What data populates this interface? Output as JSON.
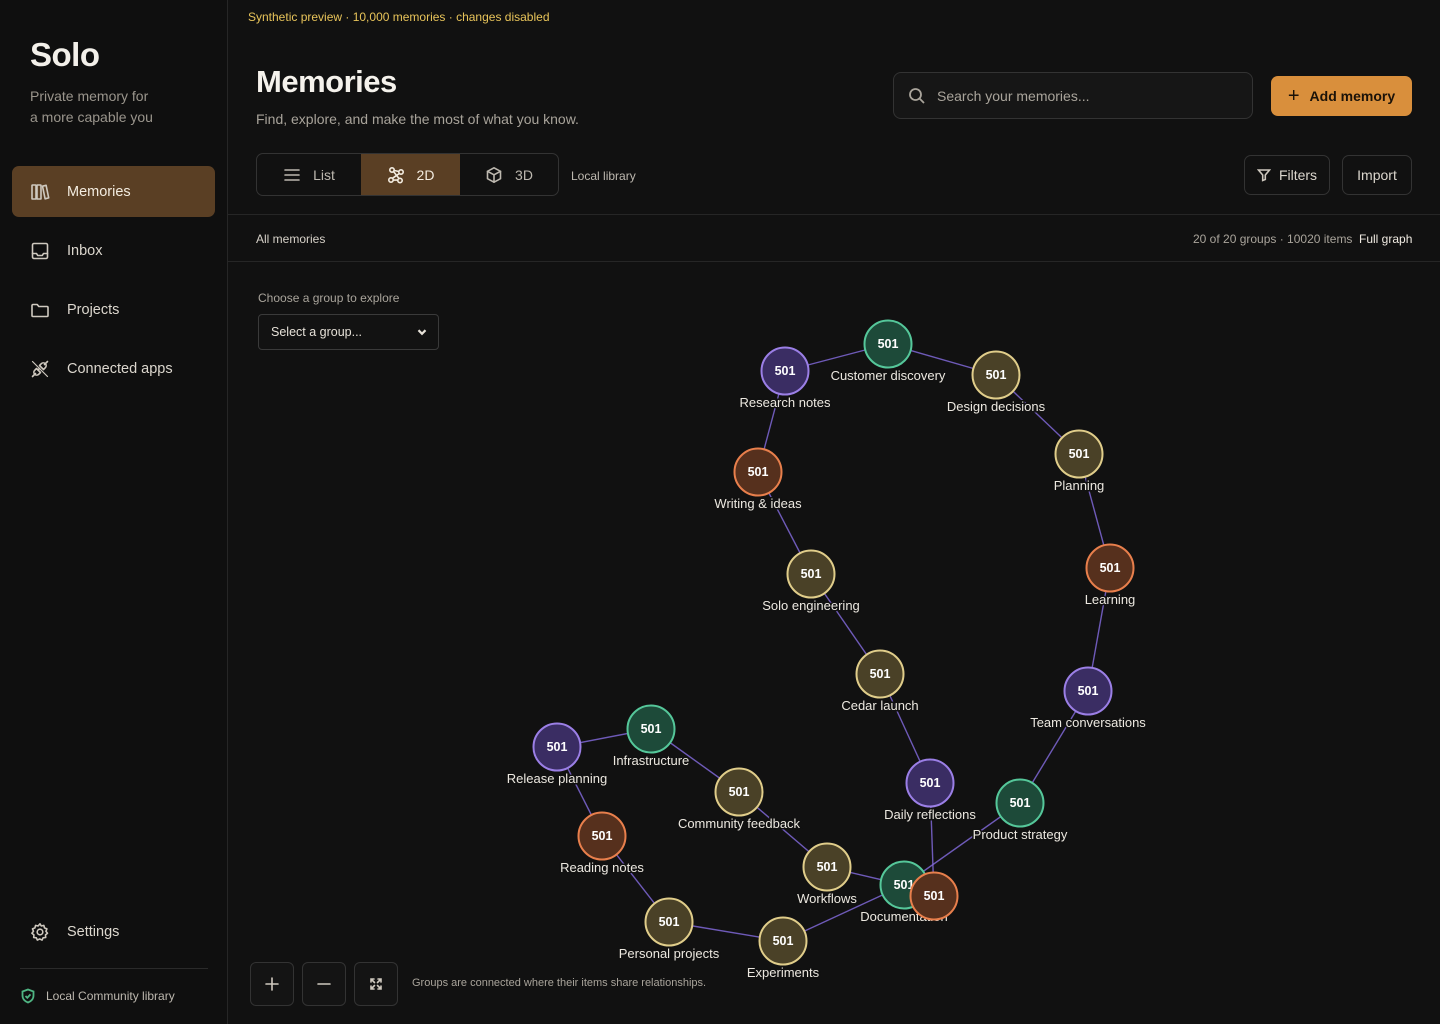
{
  "sidebar": {
    "brand": "Solo",
    "tagline_line1": "Private memory for",
    "tagline_line2": "a more capable you",
    "items": [
      {
        "label": "Memories",
        "icon": "books-icon",
        "active": true
      },
      {
        "label": "Inbox",
        "icon": "inbox-icon",
        "active": false
      },
      {
        "label": "Projects",
        "icon": "folder-icon",
        "active": false
      },
      {
        "label": "Connected apps",
        "icon": "plug-icon",
        "active": false
      }
    ],
    "settings_label": "Settings",
    "library_status": "Local Community library"
  },
  "banner": "Synthetic preview · 10,000 memories · changes disabled",
  "header": {
    "title": "Memories",
    "subtitle": "Find, explore, and make the most of what you know.",
    "search_placeholder": "Search your memories...",
    "add_label": "Add memory"
  },
  "toolbar": {
    "views": [
      {
        "label": "List",
        "icon": "list-icon",
        "active": false
      },
      {
        "label": "2D",
        "icon": "graph-2d-icon",
        "active": true
      },
      {
        "label": "3D",
        "icon": "cube-icon",
        "active": false
      }
    ],
    "library_label": "Local library",
    "filters_label": "Filters",
    "import_label": "Import"
  },
  "subheader": {
    "crumb": "All memories",
    "counts": "20 of 20 groups · 10020 items",
    "mode": "Full graph"
  },
  "explorer": {
    "choose_label": "Choose a group to explore",
    "select_value": "Select a group..."
  },
  "colors": {
    "accent": "#d98f3c",
    "active_bg": "#5a3f24",
    "purple": "#9b7fe6",
    "green": "#55c79a",
    "tan": "#e0cd8a",
    "orange": "#e87f4c",
    "edge": "#7f67d6"
  },
  "graph": {
    "nodes": [
      {
        "id": "customer",
        "label": "Customer discovery",
        "count": "501",
        "color": "green"
      },
      {
        "id": "research",
        "label": "Research notes",
        "count": "501",
        "color": "purple"
      },
      {
        "id": "design",
        "label": "Design decisions",
        "count": "501",
        "color": "tan"
      },
      {
        "id": "writing",
        "label": "Writing & ideas",
        "count": "501",
        "color": "orange"
      },
      {
        "id": "planning",
        "label": "Planning",
        "count": "501",
        "color": "tan"
      },
      {
        "id": "solo",
        "label": "Solo engineering",
        "count": "501",
        "color": "tan"
      },
      {
        "id": "learning",
        "label": "Learning",
        "count": "501",
        "color": "orange"
      },
      {
        "id": "cedar",
        "label": "Cedar launch",
        "count": "501",
        "color": "tan"
      },
      {
        "id": "team",
        "label": "Team conversations",
        "count": "501",
        "color": "purple"
      },
      {
        "id": "infra",
        "label": "Infrastructure",
        "count": "501",
        "color": "green"
      },
      {
        "id": "release",
        "label": "Release planning",
        "count": "501",
        "color": "purple"
      },
      {
        "id": "community",
        "label": "Community feedback",
        "count": "501",
        "color": "tan"
      },
      {
        "id": "daily",
        "label": "Daily reflections",
        "count": "501",
        "color": "purple"
      },
      {
        "id": "product",
        "label": "Product strategy",
        "count": "501",
        "color": "green"
      },
      {
        "id": "reading",
        "label": "Reading notes",
        "count": "501",
        "color": "orange"
      },
      {
        "id": "workflows",
        "label": "Workflows",
        "count": "501",
        "color": "tan"
      },
      {
        "id": "docs",
        "label": "Documentation",
        "count": "501",
        "color": "green"
      },
      {
        "id": "hidden",
        "label": "",
        "count": "501",
        "color": "orange"
      },
      {
        "id": "personal",
        "label": "Personal projects",
        "count": "501",
        "color": "tan"
      },
      {
        "id": "experiments",
        "label": "Experiments",
        "count": "501",
        "color": "tan"
      }
    ],
    "edges": [
      [
        "research",
        "customer"
      ],
      [
        "customer",
        "design"
      ],
      [
        "design",
        "planning"
      ],
      [
        "research",
        "writing"
      ],
      [
        "planning",
        "learning"
      ],
      [
        "writing",
        "solo"
      ],
      [
        "learning",
        "team"
      ],
      [
        "solo",
        "cedar"
      ],
      [
        "cedar",
        "daily"
      ],
      [
        "team",
        "product"
      ],
      [
        "daily",
        "hidden"
      ],
      [
        "release",
        "infra"
      ],
      [
        "infra",
        "community"
      ],
      [
        "release",
        "reading"
      ],
      [
        "community",
        "workflows"
      ],
      [
        "reading",
        "personal"
      ],
      [
        "workflows",
        "docs"
      ],
      [
        "personal",
        "experiments"
      ],
      [
        "experiments",
        "docs"
      ],
      [
        "product",
        "docs"
      ],
      [
        "docs",
        "hidden"
      ]
    ],
    "note": "Groups are connected where their items share relationships."
  }
}
